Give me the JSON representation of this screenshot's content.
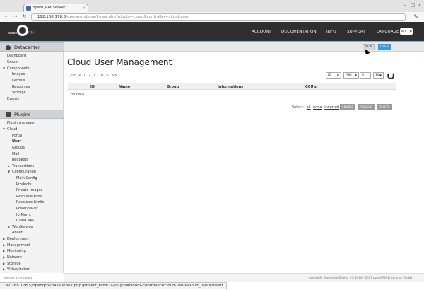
{
  "browser": {
    "tab_title": "openQRM Server",
    "close_glyph": "×",
    "url_host": "192.168.178.5",
    "url_path": "/openqrm/base/index.php?plugin=cloud&controller=cloud-user",
    "back_icon": "back-arrow-icon",
    "forward_icon": "forward-arrow-icon",
    "reload_icon": "reload-icon",
    "wrench_icon": "wrench-icon"
  },
  "app": {
    "logo_open": "open",
    "logo_rm": "RM",
    "nav": [
      "ACCOUNT",
      "DOCUMENTATION",
      "INFO",
      "SUPPORT",
      "LANGUAGE"
    ],
    "language": "en",
    "accent_color": "#3a9ad9"
  },
  "sidebar": {
    "datacenter_title": "Datacenter",
    "datacenter_items": [
      "Dashboard",
      "Server",
      "Components",
      "Images",
      "Kernels",
      "Resources",
      "Storage",
      "Events"
    ],
    "plugins_title": "Plugins",
    "plugin_items": [
      "Plugin manager",
      "Cloud",
      "Portal",
      "User",
      "Groups",
      "Mail",
      "Requests",
      "Transactions",
      "Configuration",
      "Main Config",
      "Products",
      "Private Images",
      "Resource Pools",
      "Resource Limits",
      "Power-Saver",
      "Ip-Mgmt",
      "Cloud NAT",
      "WebService",
      "About",
      "Deployment",
      "Management",
      "Monitoring",
      "Network",
      "Storage",
      "Virtualization"
    ],
    "active_item": "User"
  },
  "main": {
    "btn_new": "NEW",
    "btn_user": "USER",
    "title": "Cloud User Management",
    "pager": "<< < 0 - 0 / 0 > >>",
    "sort_field": "ID",
    "sort_order": "ASC",
    "offset": "0",
    "limit": "10",
    "columns": [
      "ID",
      "Name",
      "Group",
      "Informations",
      "CCU's"
    ],
    "no_data": "no data",
    "select_label": "Select:",
    "select_all": "all",
    "select_none": "none",
    "select_inverted": "inverted",
    "actions": [
      "ENABLE",
      "DISABLE",
      "DELETE"
    ]
  },
  "footer": {
    "copyright": "openQRM Enterprise Edition | © 2006 - 2013 openQRM Enterprise GmbH",
    "memory": "Memory: 4279.9 bytes"
  },
  "status_url": "192.168.178.5/openqrm/base/index.php?project_tab=1&plugin=cloud&controller=cloud-user&cloud_user=insert"
}
